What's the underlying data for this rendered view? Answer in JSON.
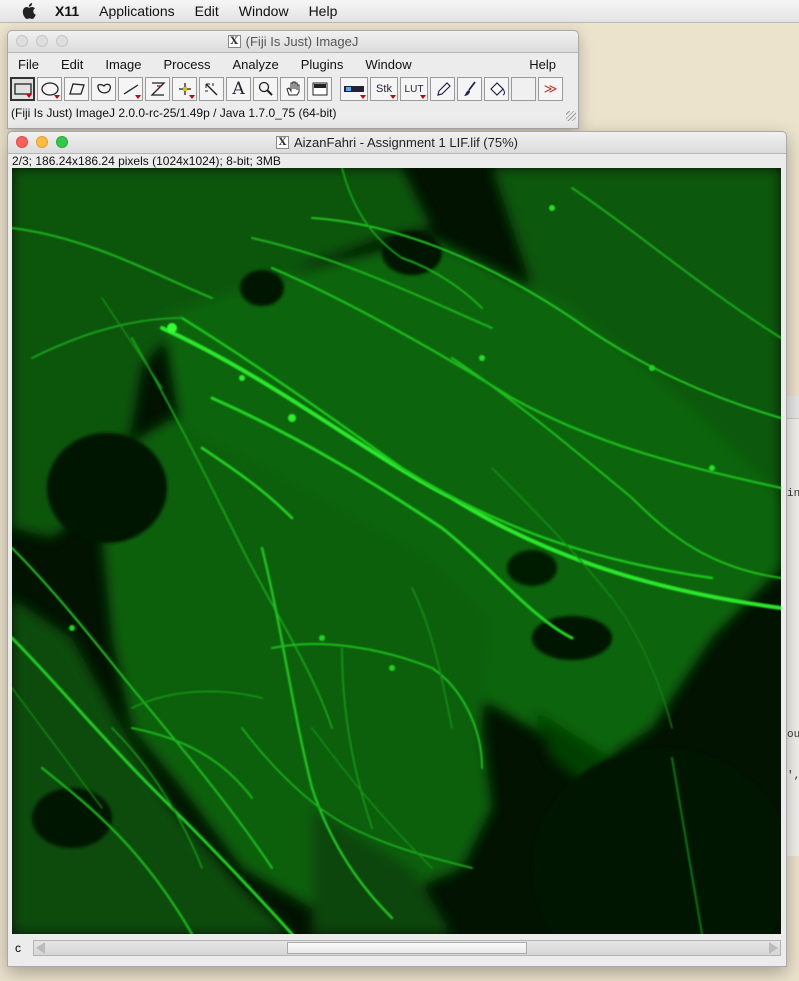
{
  "menubar": {
    "apple_icon": "apple-icon",
    "app_name": "X11",
    "items": [
      "Applications",
      "Edit",
      "Window",
      "Help"
    ]
  },
  "imagej_window": {
    "title": "(Fiji Is Just) ImageJ",
    "menus": [
      "File",
      "Edit",
      "Image",
      "Process",
      "Analyze",
      "Plugins",
      "Window"
    ],
    "help_menu": "Help",
    "tools": {
      "rectangle": "rectangle-selection-icon",
      "oval": "oval-selection-icon",
      "polygon": "polygon-selection-icon",
      "freehand": "freehand-selection-icon",
      "line": "line-selection-icon",
      "angle": "angle-tool-icon",
      "point": "point-tool-icon",
      "wand": "wand-tool-icon",
      "text": "text-tool-icon",
      "magnifier": "magnifying-glass-icon",
      "hand": "hand-scroll-icon",
      "dropper": "color-picker-icon",
      "dev_label": "Dev",
      "stk_label": "Stk",
      "lut_label": "LUT",
      "pencil": "pencil-icon",
      "brush": "paintbrush-icon",
      "flood": "flood-fill-icon",
      "more": "≫"
    },
    "status": "(Fiji Is Just) ImageJ 2.0.0-rc-25/1.49p / Java 1.7.0_75 (64-bit)"
  },
  "image_window": {
    "title": "AizanFahri - Assignment 1 LIF.lif (75%)",
    "info": "2/3; 186.24x186.24 pixels (1024x1024); 8-bit; 3MB",
    "channel_label": "c",
    "channel_position": 0.5
  },
  "background_doc": {
    "fragments": [
      "in",
      "out",
      "',"
    ]
  },
  "colors": {
    "fluorescence": "#22d422",
    "image_background": "#021302",
    "close": "#fc605b",
    "minimize": "#fdbc40",
    "zoom": "#34c84a"
  }
}
